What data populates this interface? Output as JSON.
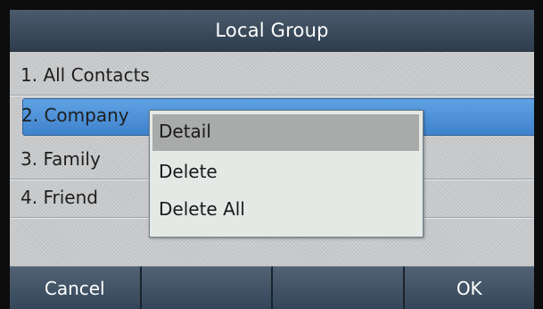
{
  "header": {
    "title": "Local Group"
  },
  "list": {
    "items": [
      {
        "label": "1. All Contacts",
        "selected": false
      },
      {
        "label": "2. Company",
        "selected": true
      },
      {
        "label": "3. Family",
        "selected": false
      },
      {
        "label": "4. Friend",
        "selected": false
      }
    ]
  },
  "popup_menu": {
    "options": [
      {
        "label": "Detail",
        "highlighted": true
      },
      {
        "label": "Delete",
        "highlighted": false
      },
      {
        "label": "Delete All",
        "highlighted": false
      }
    ]
  },
  "softkeys": [
    {
      "label": "Cancel"
    },
    {
      "label": ""
    },
    {
      "label": ""
    },
    {
      "label": "OK"
    }
  ],
  "colors": {
    "title_bar": "#3d4e60",
    "selection": "#4f92d9",
    "popup_highlight": "#a9aaaa",
    "popup_background": "#e4e9e6",
    "softkey": "#42546a",
    "background": "#c7c9cb"
  }
}
